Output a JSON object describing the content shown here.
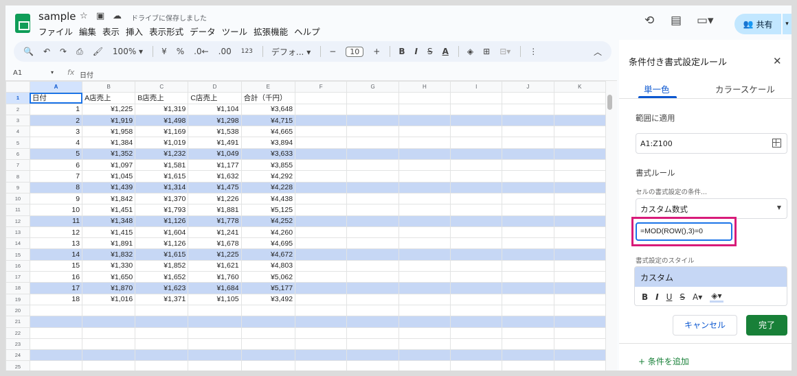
{
  "header": {
    "doc_title": "sample",
    "save_status": "ドライブに保存しました",
    "menus": [
      "ファイル",
      "編集",
      "表示",
      "挿入",
      "表示形式",
      "データ",
      "ツール",
      "拡張機能",
      "ヘルプ"
    ],
    "share_label": "共有"
  },
  "toolbar": {
    "zoom": "100%",
    "currency": "¥",
    "percent": "%",
    "dec_decrease": ".0←",
    "dec_increase": ".00",
    "number_format": "123",
    "font_family": "デフォ...",
    "font_size": "10"
  },
  "formula_bar": {
    "cell_ref": "A1",
    "content": "日付"
  },
  "sheet": {
    "columns": [
      "A",
      "B",
      "C",
      "D",
      "E",
      "F",
      "G",
      "H",
      "I",
      "J",
      "K"
    ],
    "header_row": [
      "日付",
      "A店売上",
      "B店売上",
      "C店売上",
      "合計（千円）"
    ],
    "rows": [
      [
        1,
        "¥1,225",
        "¥1,319",
        "¥1,104",
        "¥3,648"
      ],
      [
        2,
        "¥1,919",
        "¥1,498",
        "¥1,298",
        "¥4,715"
      ],
      [
        3,
        "¥1,958",
        "¥1,169",
        "¥1,538",
        "¥4,665"
      ],
      [
        4,
        "¥1,384",
        "¥1,019",
        "¥1,491",
        "¥3,894"
      ],
      [
        5,
        "¥1,352",
        "¥1,232",
        "¥1,049",
        "¥3,633"
      ],
      [
        6,
        "¥1,097",
        "¥1,581",
        "¥1,177",
        "¥3,855"
      ],
      [
        7,
        "¥1,045",
        "¥1,615",
        "¥1,632",
        "¥4,292"
      ],
      [
        8,
        "¥1,439",
        "¥1,314",
        "¥1,475",
        "¥4,228"
      ],
      [
        9,
        "¥1,842",
        "¥1,370",
        "¥1,226",
        "¥4,438"
      ],
      [
        10,
        "¥1,451",
        "¥1,793",
        "¥1,881",
        "¥5,125"
      ],
      [
        11,
        "¥1,348",
        "¥1,126",
        "¥1,778",
        "¥4,252"
      ],
      [
        12,
        "¥1,415",
        "¥1,604",
        "¥1,241",
        "¥4,260"
      ],
      [
        13,
        "¥1,891",
        "¥1,126",
        "¥1,678",
        "¥4,695"
      ],
      [
        14,
        "¥1,832",
        "¥1,615",
        "¥1,225",
        "¥4,672"
      ],
      [
        15,
        "¥1,330",
        "¥1,852",
        "¥1,621",
        "¥4,803"
      ],
      [
        16,
        "¥1,650",
        "¥1,652",
        "¥1,760",
        "¥5,062"
      ],
      [
        17,
        "¥1,870",
        "¥1,623",
        "¥1,684",
        "¥5,177"
      ],
      [
        18,
        "¥1,016",
        "¥1,371",
        "¥1,105",
        "¥3,492"
      ]
    ],
    "visible_row_numbers": [
      1,
      2,
      3,
      4,
      5,
      6,
      7,
      8,
      9,
      10,
      11,
      12,
      13,
      14,
      15,
      16,
      17,
      18,
      19,
      20,
      21,
      22,
      23,
      24,
      25
    ],
    "highlight_color": "#c6d7f5"
  },
  "panel": {
    "title": "条件付き書式設定ルール",
    "tab_single": "単一色",
    "tab_scale": "カラースケール",
    "range_label": "範囲に適用",
    "range_value": "A1:Z100",
    "rules_label": "書式ルール",
    "condition_label": "セルの書式設定の条件...",
    "condition_value": "カスタム数式",
    "formula_value": "=MOD(ROW(),3)=0",
    "style_label": "書式設定のスタイル",
    "style_preview": "カスタム",
    "cancel_label": "キャンセル",
    "done_label": "完了",
    "add_condition_label": "+ 条件を追加",
    "accent_color": "#0b57d0",
    "done_color": "#188038",
    "callout_color": "#d81b79"
  }
}
